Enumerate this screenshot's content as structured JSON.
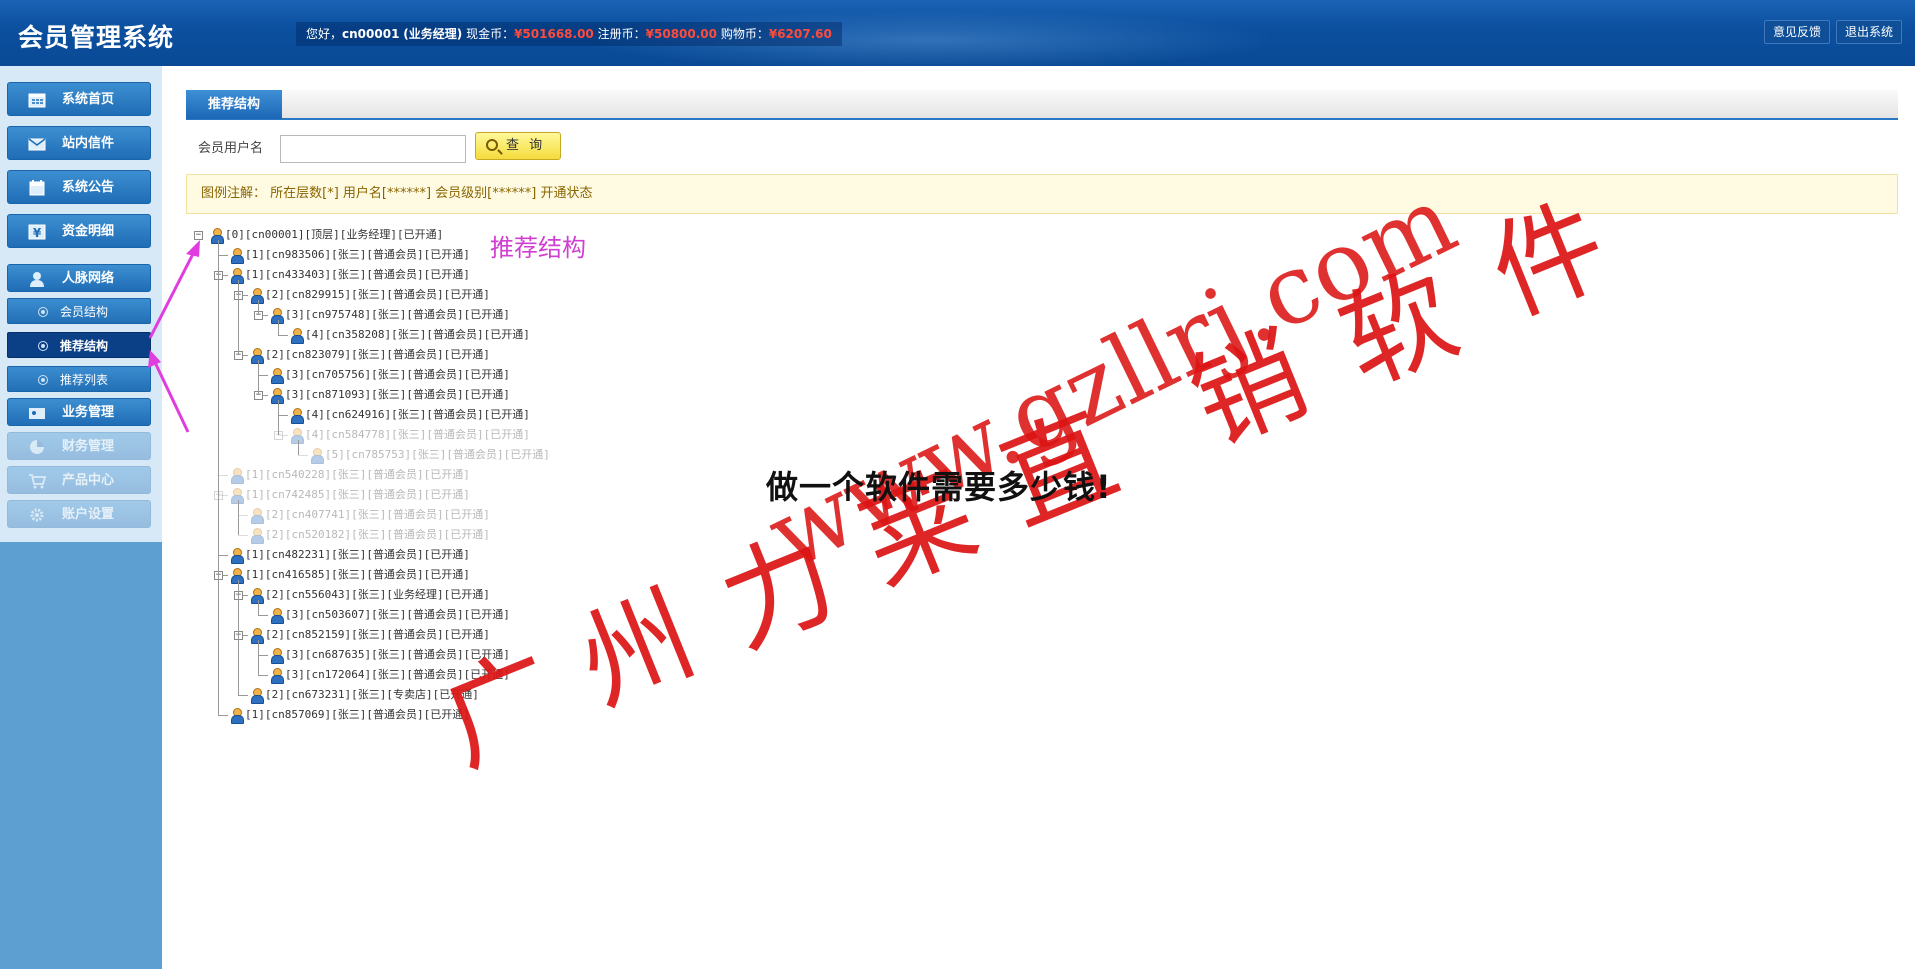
{
  "header": {
    "app_title": "会员管理系统",
    "greeting": "您好，",
    "username": "cn00001",
    "role": "(业务经理)",
    "cash_label": "现金币：",
    "cash_value": "¥501668.00",
    "reg_label": "注册币：",
    "reg_value": "¥50800.00",
    "shop_label": "购物币：",
    "shop_value": "¥6207.60",
    "feedback_label": "意见反馈",
    "logout_label": "退出系统"
  },
  "sidebar": {
    "items": [
      {
        "label": "系统首页",
        "icon": "calendar-icon"
      },
      {
        "label": "站内信件",
        "icon": "mail-icon"
      },
      {
        "label": "系统公告",
        "icon": "notice-icon"
      },
      {
        "label": "资金明细",
        "icon": "money-icon"
      },
      {
        "label": "人脉网络",
        "icon": "person-icon"
      },
      {
        "label": "会员结构",
        "icon": "dot-icon"
      },
      {
        "label": "推荐结构",
        "icon": "dot-icon"
      },
      {
        "label": "推荐列表",
        "icon": "dot-icon"
      },
      {
        "label": "业务管理",
        "icon": "business-icon"
      },
      {
        "label": "财务管理",
        "icon": "finance-icon"
      },
      {
        "label": "产品中心",
        "icon": "cart-icon"
      },
      {
        "label": "账户设置",
        "icon": "gear-icon"
      }
    ]
  },
  "main": {
    "tab_label": "推荐结构",
    "search_label": "会员用户名",
    "search_value": "",
    "search_button": "查 询",
    "legend": "图例注解：  所在层数[*]  用户名[******]  会员级别[******]  开通状态"
  },
  "tree": [
    "[0][cn00001][顶层][业务经理][已开通]",
    "[1][cn983506][张三][普通会员][已开通]",
    "[1][cn433403][张三][普通会员][已开通]",
    "[2][cn829915][张三][普通会员][已开通]",
    "[3][cn975748][张三][普通会员][已开通]",
    "[4][cn358208][张三][普通会员][已开通]",
    "[2][cn823079][张三][普通会员][已开通]",
    "[3][cn705756][张三][普通会员][已开通]",
    "[3][cn871093][张三][普通会员][已开通]",
    "[4][cn624916][张三][普通会员][已开通]",
    "[4][cn584778][张三][普通会员][已开通]",
    "[5][cn785753][张三][普通会员][已开通]",
    "[1][cn540228][张三][普通会员][已开通]",
    "[1][cn742485][张三][普通会员][已开通]",
    "[2][cn407741][张三][普通会员][已开通]",
    "[2][cn520182][张三][普通会员][已开通]",
    "[1][cn482231][张三][普通会员][已开通]",
    "[1][cn416585][张三][普通会员][已开通]",
    "[2][cn556043][张三][业务经理][已开通]",
    "[3][cn503607][张三][普通会员][已开通]",
    "[2][cn852159][张三][普通会员][已开通]",
    "[3][cn687635][张三][普通会员][已开通]",
    "[3][cn172064][张三][普通会员][已开通]",
    "[2][cn673231][张三][专卖店][已开通]",
    "[1][cn857069][张三][普通会员][已开通]"
  ],
  "annotation": "推荐结构",
  "overlay_title": "做一个软件需要多少钱!",
  "watermark": {
    "chars": [
      "广",
      "州",
      "力",
      "莱",
      "直",
      "销",
      "软",
      "件"
    ],
    "url": "www.gzllrj.com"
  },
  "colors": {
    "accent": "#1c67b6",
    "active_menu": "#0b3f86",
    "money_red": "#ff4b3a",
    "annotation_magenta": "#d03fd0",
    "watermark_red": "#dc1414"
  }
}
